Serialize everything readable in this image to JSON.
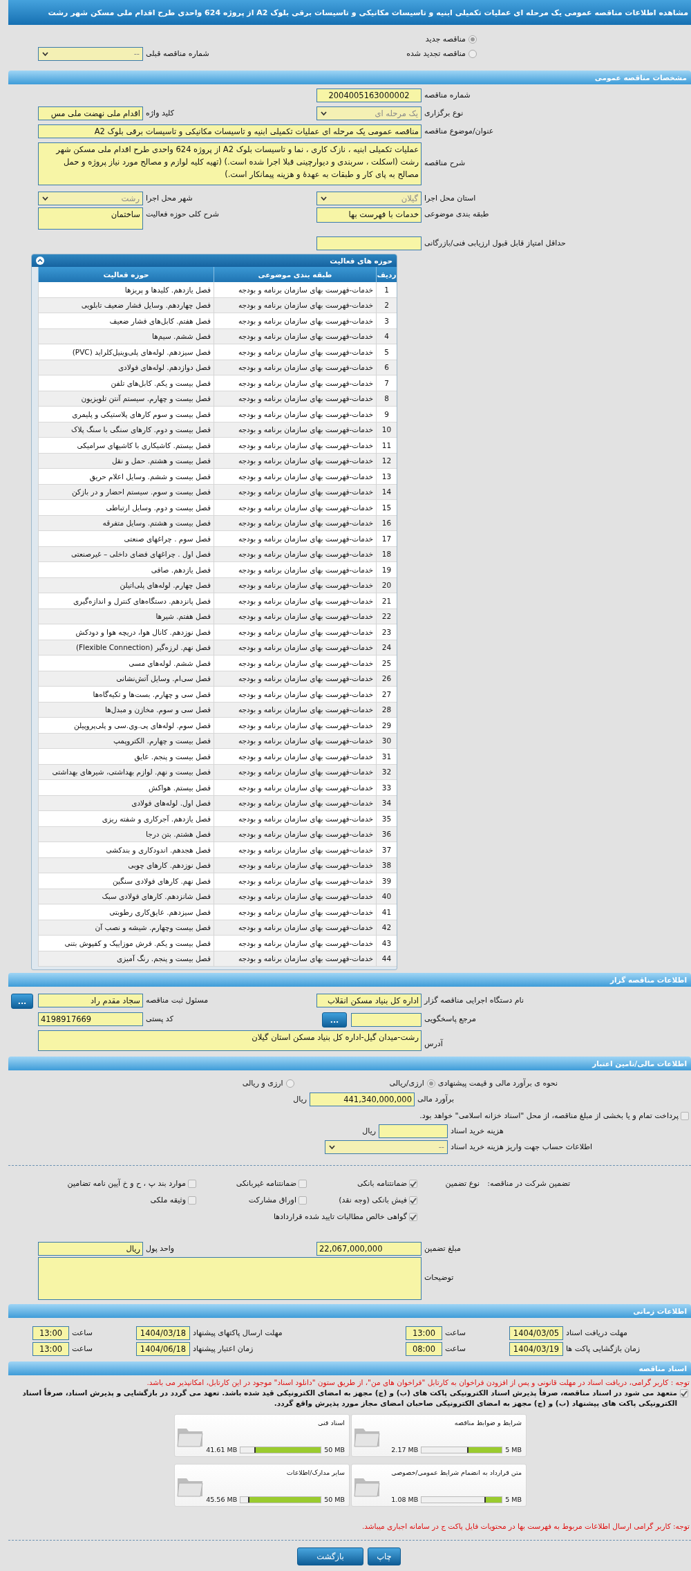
{
  "title": "مشاهده اطلاعات مناقصه عمومی یک مرحله ای عملیات تکمیلی ابنیه و تاسیسات مکانیکی و تاسیسات برقی بلوک A2 از پروژه 624 واحدی طرح اقدام ملی مسکن شهر رشت",
  "tender_kind": [
    {
      "label": "مناقصه جدید",
      "selected": true
    },
    {
      "label": "مناقصه تجدید شده",
      "selected": false
    }
  ],
  "previous_tender": {
    "label": "شماره مناقصه قبلی",
    "value": "--"
  },
  "general": {
    "title": "مشخصات مناقصه عمومی",
    "number": {
      "label": "شماره مناقصه",
      "value": "2004005163000002"
    },
    "holding_type": {
      "label": "نوع برگزاری",
      "value": "یک مرحله ای"
    },
    "keyword": {
      "label": "کلید واژه",
      "value": "اقدام ملی نهضت ملی مس"
    },
    "subject": {
      "label": "عنوان/موضوع مناقصه",
      "value": "مناقصه عمومی یک مرحله ای عملیات تکمیلی ابنیه و تاسیسات مکانیکی و تاسیسات برقی بلوک A2"
    },
    "description": {
      "label": "شرح مناقصه",
      "value": "عملیات تکمیلی ابنیه ، نازک کاری ، نما و تاسیسات بلوک A2  از پروژه 624 واحدی طرح اقدام ملی مسکن شهر رشت (اسکلت ، سربندی و دیوارچینی قبلا اجرا شده است.)  (تهیه  کلیه لوازم و مصالح مورد نیاز پروژه و حمل مصالح به  پای کار و طبقات به عهدهٔ و هزینه پیمانکار است.)"
    },
    "province": {
      "label": "استان محل اجرا",
      "value": "گیلان"
    },
    "city": {
      "label": "شهر محل اجرا",
      "value": "رشت"
    },
    "category": {
      "label": "طبقه بندی موضوعی",
      "value": "خدمات با فهرست بها"
    },
    "activity_summary": {
      "label": "شرح کلی حوزه فعالیت",
      "value": "ساختمان"
    },
    "min_score": {
      "label": "حداقل امتیاز قابل قبول ارزیابی فنی/بازرگانی"
    }
  },
  "activities": {
    "title": "حوزه های فعالیت",
    "columns": [
      "ردیف",
      "طبقه بندی موضوعی",
      "حوزه فعالیت"
    ],
    "rows": [
      [
        "1",
        "خدمات-فهرست بهای سازمان برنامه و بودجه",
        "فصل یازدهم. کلیدها و پریزها"
      ],
      [
        "2",
        "خدمات-فهرست بهای سازمان برنامه و بودجه",
        "فصل چهاردهم. وسایل فشار ضعیف تابلویی"
      ],
      [
        "3",
        "خدمات-فهرست بهای سازمان برنامه و بودجه",
        "فصل هفتم. کابل‌های فشار ضعیف"
      ],
      [
        "4",
        "خدمات-فهرست بهای سازمان برنامه و بودجه",
        "فصل ششم. سیم‌ها"
      ],
      [
        "5",
        "خدمات-فهرست بهای سازمان برنامه و بودجه",
        "فصل سیزدهم. لوله‌های پلی‌وینیل‌کلراید (PVC)"
      ],
      [
        "6",
        "خدمات-فهرست بهای سازمان برنامه و بودجه",
        "فصل دوازدهم. لوله‌های فولادی"
      ],
      [
        "7",
        "خدمات-فهرست بهای سازمان برنامه و بودجه",
        "فصل بیست و یکم. کابل‌های تلفن"
      ],
      [
        "8",
        "خدمات-فهرست بهای سازمان برنامه و بودجه",
        "فصل بیست و چهارم. سیستم آنتن تلویزیون"
      ],
      [
        "9",
        "خدمات-فهرست بهای سازمان برنامه و بودجه",
        "فصل بیست و سوم کارهای پلاستیکی و پلیمری"
      ],
      [
        "10",
        "خدمات-فهرست بهای سازمان برنامه و بودجه",
        "فصل بیست و دوم. کارهای سنگی با سنگ پلاک"
      ],
      [
        "11",
        "خدمات-فهرست بهای سازمان برنامه و بودجه",
        "فصل بیستم. کاشیکاری با کاشیهای سرامیکی"
      ],
      [
        "12",
        "خدمات-فهرست بهای سازمان برنامه و بودجه",
        "فصل بیست و هشتم. حمل و نقل"
      ],
      [
        "13",
        "خدمات-فهرست بهای سازمان برنامه و بودجه",
        "فصل بیست و ششم. وسایل اعلام حریق"
      ],
      [
        "14",
        "خدمات-فهرست بهای سازمان برنامه و بودجه",
        "فصل بیست و سوم. سیستم احضار و در بازکن"
      ],
      [
        "15",
        "خدمات-فهرست بهای سازمان برنامه و بودجه",
        "فصل بیست و دوم. وسایل ارتباطی"
      ],
      [
        "16",
        "خدمات-فهرست بهای سازمان برنامه و بودجه",
        "فصل بیست و هشتم. وسایل متفرقه"
      ],
      [
        "17",
        "خدمات-فهرست بهای سازمان برنامه و بودجه",
        "فصل سوم . چراغهای صنعتی"
      ],
      [
        "18",
        "خدمات-فهرست بهای سازمان برنامه و بودجه",
        "فصل اول . چراغهای فضای داخلی – غیرصنعتی"
      ],
      [
        "19",
        "خدمات-فهرست بهای سازمان برنامه و بودجه",
        "فصل یازدهم. صافی"
      ],
      [
        "20",
        "خدمات-فهرست بهای سازمان برنامه و بودجه",
        "فصل چهارم. لوله‌های پلی‌اتیلن"
      ],
      [
        "21",
        "خدمات-فهرست بهای سازمان برنامه و بودجه",
        "فصل پانزدهم. دستگاه‌های کنترل و اندازه‌گیری"
      ],
      [
        "22",
        "خدمات-فهرست بهای سازمان برنامه و بودجه",
        "فصل هفتم. شیرها"
      ],
      [
        "23",
        "خدمات-فهرست بهای سازمان برنامه و بودجه",
        "فصل نوزدهم. کانال هوا، دریچه هوا و دودکش"
      ],
      [
        "24",
        "خدمات-فهرست بهای سازمان برنامه و بودجه",
        "فصل نهم. لرزه‌گیر (Flexible Connection)"
      ],
      [
        "25",
        "خدمات-فهرست بهای سازمان برنامه و بودجه",
        "فصل ششم. لوله‌های مسی"
      ],
      [
        "26",
        "خدمات-فهرست بهای سازمان برنامه و بودجه",
        "فصل سی‌ام. وسایل آتش‌نشانی"
      ],
      [
        "27",
        "خدمات-فهرست بهای سازمان برنامه و بودجه",
        "فصل سی و چهارم. بست‌ها و تکیه‌گاه‌ها"
      ],
      [
        "28",
        "خدمات-فهرست بهای سازمان برنامه و بودجه",
        "فصل سی و سوم. مخازن و مبدل‌ها"
      ],
      [
        "29",
        "خدمات-فهرست بهای سازمان برنامه و بودجه",
        "فصل سوم. لوله‌های پی.وی.سی و پلی‌پروپیلن"
      ],
      [
        "30",
        "خدمات-فهرست بهای سازمان برنامه و بودجه",
        "فصل بیست و چهارم. الکتروپمپ"
      ],
      [
        "31",
        "خدمات-فهرست بهای سازمان برنامه و بودجه",
        "فصل بیست و پنجم. عایق"
      ],
      [
        "32",
        "خدمات-فهرست بهای سازمان برنامه و بودجه",
        "فصل بیست و نهم. لوازم بهداشتی، شیرهای بهداشتی"
      ],
      [
        "33",
        "خدمات-فهرست بهای سازمان برنامه و بودجه",
        "فصل بیستم. هواکش"
      ],
      [
        "34",
        "خدمات-فهرست بهای سازمان برنامه و بودجه",
        "فصل اول. لوله‌های فولادی"
      ],
      [
        "35",
        "خدمات-فهرست بهای سازمان برنامه و بودجه",
        "فصل یازدهم. آجرکاری و شفته ریزی"
      ],
      [
        "36",
        "خدمات-فهرست بهای سازمان برنامه و بودجه",
        "فصل هشتم. بتن درجا"
      ],
      [
        "37",
        "خدمات-فهرست بهای سازمان برنامه و بودجه",
        "فصل هجدهم. اندودکاری و بندکشی"
      ],
      [
        "38",
        "خدمات-فهرست بهای سازمان برنامه و بودجه",
        "فصل نوزدهم. کارهای چوبی"
      ],
      [
        "39",
        "خدمات-فهرست بهای سازمان برنامه و بودجه",
        "فصل نهم. کارهای فولادی سنگین"
      ],
      [
        "40",
        "خدمات-فهرست بهای سازمان برنامه و بودجه",
        "فصل شانزدهم. کارهای فولادی سبک"
      ],
      [
        "41",
        "خدمات-فهرست بهای سازمان برنامه و بودجه",
        "فصل سیزدهم. عایق‌کاری رطوبتی"
      ],
      [
        "42",
        "خدمات-فهرست بهای سازمان برنامه و بودجه",
        "فصل بیست وچهارم. شیشه و نصب آن"
      ],
      [
        "43",
        "خدمات-فهرست بهای سازمان برنامه و بودجه",
        "فصل بیست و یکم. فرش موزاییک و کفپوش بتنی"
      ],
      [
        "44",
        "خدمات-فهرست بهای سازمان برنامه و بودجه",
        "فصل بیست و پنجم. رنگ آمیزی"
      ]
    ]
  },
  "organizer": {
    "title": "اطلاعات مناقصه گزار",
    "agency": {
      "label": "نام دستگاه اجرایی مناقصه گزار",
      "value": "اداره کل بنیاد مسکن انقلاب"
    },
    "registrar": {
      "label": "مسئول ثبت مناقصه",
      "value": "سجاد  مقدم راد",
      "button": "..."
    },
    "reference": {
      "label": "مرجع پاسخگویی",
      "button": "..."
    },
    "postal_code": {
      "label": "کد پستی",
      "value": "4198917669"
    },
    "address": {
      "label": "آدرس",
      "value": "رشت-میدان گیل-اداره کل بنیاد مسکن استان گیلان"
    }
  },
  "financial": {
    "title": "اطلاعات مالی/تامین اعتبار",
    "pricing": {
      "label": "نحوه ی برآورد مالی و قیمت پیشنهادی",
      "options": [
        {
          "label": "ارزی/ریالی",
          "selected": true
        },
        {
          "label": "ارزی و ریالی",
          "selected": false
        }
      ]
    },
    "estimate": {
      "label": "برآورد مالی",
      "value": "441,340,000,000",
      "unit": "ریال"
    },
    "treasury": {
      "label": "پرداخت تمام و یا بخشی از مبلغ مناقصه، از محل \"اسناد خزانه اسلامی\" خواهد بود.",
      "checked": false
    },
    "doc_fee": {
      "label": "هزینه خرید اسناد",
      "unit": "ریال"
    },
    "account": {
      "label": "اطلاعات حساب جهت واریز هزینه خرید اسناد",
      "value": "--"
    }
  },
  "guarantee": {
    "label": "تضمین شرکت در مناقصه:",
    "type_label": "نوع تضمین",
    "options": [
      {
        "label": "ضمانتنامه بانکی",
        "checked": true
      },
      {
        "label": "ضمانتنامه غیربانکی",
        "checked": false
      },
      {
        "label": "موارد بند پ ، ح و خ آیین نامه تضامین",
        "checked": false
      },
      {
        "label": "فیش بانکی (وجه نقد)",
        "checked": true
      },
      {
        "label": "اوراق مشارکت",
        "checked": false
      },
      {
        "label": "وثیقه ملکی",
        "checked": false
      },
      {
        "label": "گواهی خالص مطالبات تایید شده قراردادها",
        "checked": true
      }
    ],
    "amount": {
      "label": "مبلغ تضمین",
      "value": "22,067,000,000"
    },
    "currency": {
      "label": "واحد پول",
      "value": "ریال"
    },
    "notes": {
      "label": "توضیحات"
    }
  },
  "timing": {
    "title": "اطلاعات زمانی",
    "items": [
      {
        "label": "مهلت دریافت اسناد",
        "date": "1404/03/05",
        "time_label": "ساعت",
        "time": "13:00"
      },
      {
        "label": "مهلت ارسال پاکتهای پیشنهاد",
        "date": "1404/03/18",
        "time_label": "ساعت",
        "time": "13:00"
      },
      {
        "label": "زمان بازگشایی پاکت ها",
        "date": "1404/03/19",
        "time_label": "ساعت",
        "time": "08:00"
      },
      {
        "label": "زمان اعتبار پیشنهاد",
        "date": "1404/06/18",
        "time_label": "ساعت",
        "time": "13:00"
      }
    ]
  },
  "documents": {
    "title": "اسناد مناقصه",
    "notice": "توجه : کاربر گرامی، دریافت اسناد در مهلت قانونی و پس از افزودن فراخوان به کارتابل \"فراخوان های من\"، از طریق ستون \"دانلود اسناد\" موجود در این کارتابل، امکانپذیر می باشد.",
    "pledge": {
      "text": "متعهد می شود در اسناد مناقصه، صرفاً پذیرش اسناد الکترونیکی پاکت های (ب) و (ج) مجهز به امضای الکترونیکی قید شده باشد. تعهد می گردد در بازگشایی و پذیرش اسناد، صرفاً اسناد الکترونیکی پاکت های پیشنهاد (ب) و (ج) مجهز به امضای الکترونیکی صاحبان امضای مجاز مورد پذیرش واقع گردد.",
      "checked": true
    },
    "files": [
      {
        "name": "شرایط و ضوابط مناقصه",
        "limit": "5 MB",
        "size": "2.17 MB",
        "level": 0.434
      },
      {
        "name": "اسناد فنی",
        "limit": "50 MB",
        "size": "41.61 MB",
        "level": 0.832
      },
      {
        "name": "متن قرارداد به انضمام شرایط عمومی/خصوصی",
        "limit": "5 MB",
        "size": "1.08 MB",
        "level": 0.216
      },
      {
        "name": "سایر مدارک/اطلاعات",
        "limit": "50 MB",
        "size": "45.56 MB",
        "level": 0.911
      }
    ],
    "footer_notice": "توجه: کاربر گرامی ارسال اطلاعات مربوط به فهرست بها در محتویات فایل پاکت ج در سامانه اجباری میباشد."
  },
  "buttons": [
    "چاپ",
    "بازگشت"
  ]
}
